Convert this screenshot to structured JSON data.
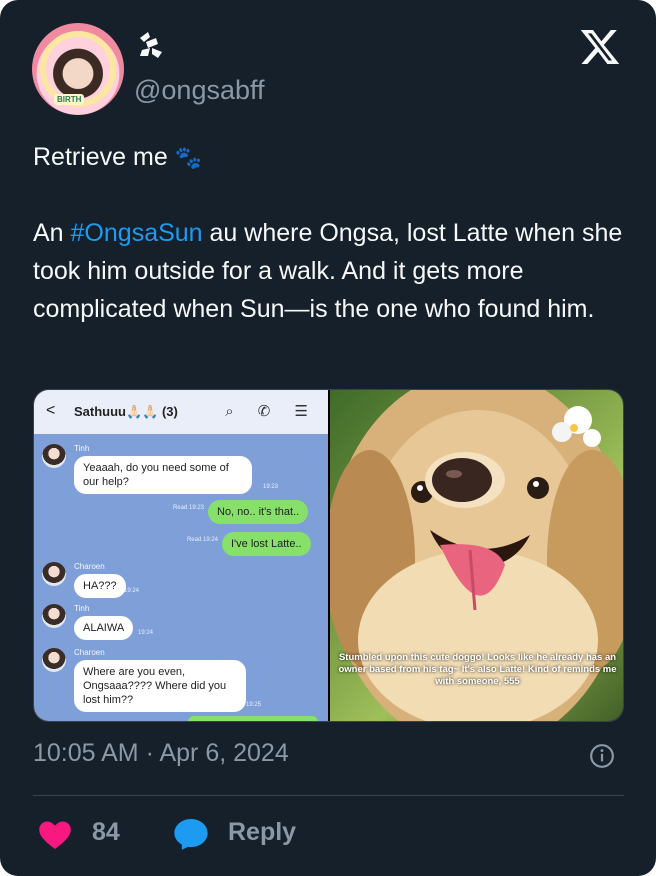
{
  "tweet": {
    "handle": "@ongsabff",
    "text_line1": "Retrieve me",
    "paw_glyph": "🐾",
    "body_prefix": "An ",
    "hashtag": "#OngsaSun",
    "body_rest": " au where Ongsa, lost Latte when she took him outside for a walk. And it gets more complicated when Sun—is the one who found him.",
    "timestamp": "10:05 AM · Apr 6, 2024",
    "likes": "84",
    "reply_label": "Reply"
  },
  "chat": {
    "title": "Sathuuu🙏🏻🙏🏻 (3)",
    "back": "<",
    "icons": "⌕ ✆ ☰",
    "messages": [
      {
        "sender": "Tinh",
        "text": "Yeaaah, do you need some of our help?",
        "time": "19:23"
      },
      {
        "text": "No, no.. it's that..",
        "time": "Read 19:23"
      },
      {
        "text": "I've lost Latte..",
        "time": "Read 19:24"
      },
      {
        "sender": "Charoen",
        "text": "HA???",
        "time": "19:24"
      },
      {
        "sender": "Tinh",
        "text": "ALAIWA",
        "time": "19:24"
      },
      {
        "sender": "Charoen",
        "text": "Where are you even, Ongsaaa???? Where did you lost him??",
        "time": "19:25"
      }
    ]
  },
  "photo": {
    "caption": "Stumbled upon this cute doggo! Looks like he already has an owner based from his tag~ It's also Latte! Kind of reminds me with someone, 555"
  },
  "colors": {
    "background": "#15202b",
    "text": "#f7f9f9",
    "muted": "#8b98a5",
    "link": "#1d9bf0",
    "like": "#f91880"
  }
}
